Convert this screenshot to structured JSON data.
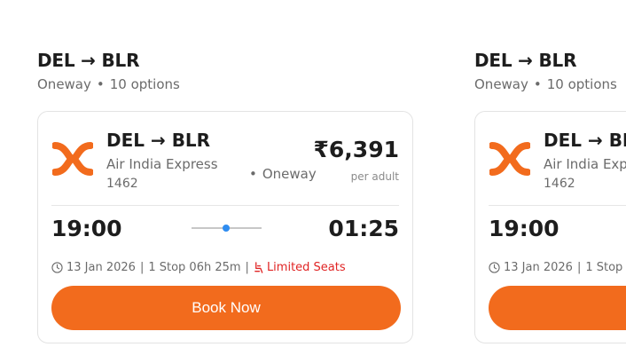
{
  "cards": [
    {
      "route_title": "DEL → BLR",
      "trip_type": "Oneway",
      "options": "10 options",
      "card_route": "DEL → BLR",
      "airline": "Air India Express",
      "flight_no": "1462",
      "trip_type_card": "Oneway",
      "price": "₹6,391",
      "per_adult": "per adult",
      "dep_time": "19:00",
      "arr_time": "01:25",
      "date": "13 Jan 2026",
      "stops": "1 Stop 06h 25m",
      "limited": "Limited Seats",
      "book_label": "Book Now"
    },
    {
      "route_title": "DEL → BLR",
      "trip_type": "Oneway",
      "options": "10 options",
      "card_route": "DEL → BL",
      "airline": "Air India Exp",
      "flight_no": "1462",
      "dep_time": "19:00",
      "date": "13 Jan 2026",
      "stops": "1 Stop"
    }
  ],
  "colors": {
    "accent": "#f26b1d",
    "limited": "#e02424",
    "timeline_dot": "#2f8cf0"
  },
  "icons": [
    "airline-logo-icon",
    "clock-icon",
    "seat-icon"
  ]
}
